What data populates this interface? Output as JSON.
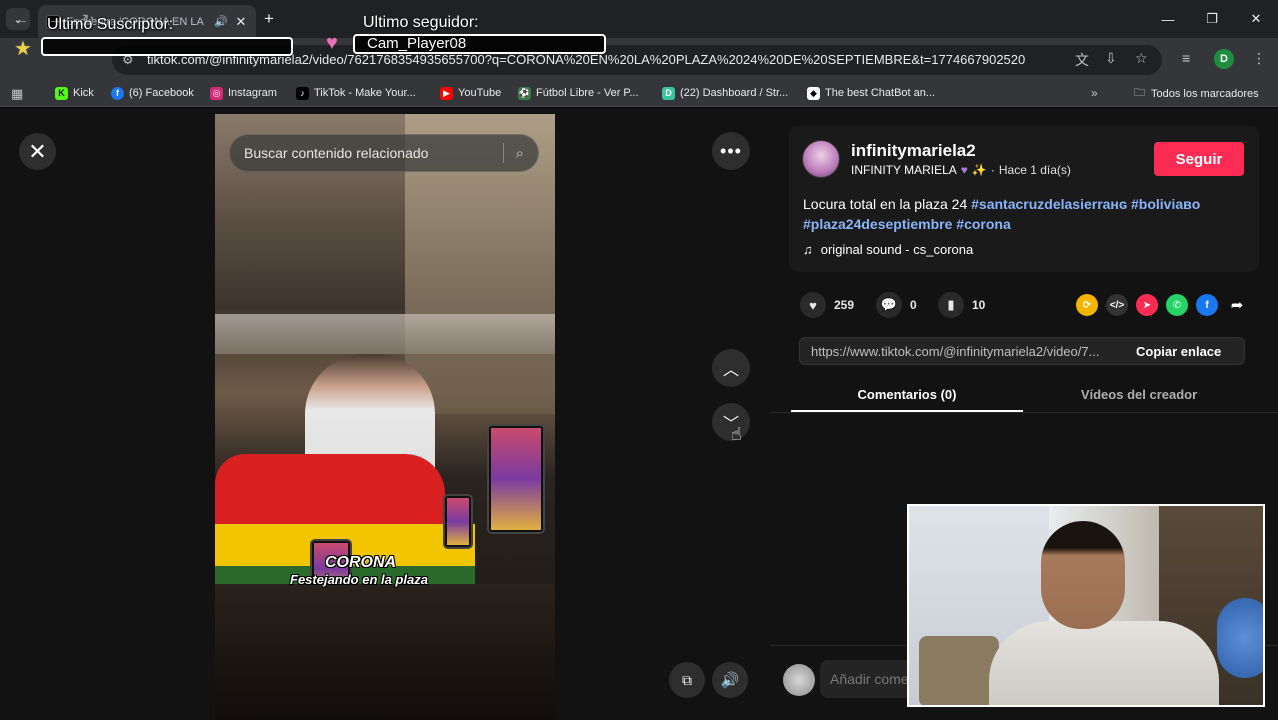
{
  "browser": {
    "tab_title": "Encuentra 'CORONA EN LA",
    "url": "tiktok.com/@infinitymariela2/video/7621768354935655700?q=CORONA%20EN%20LA%20PLAZA%2024%20DE%20SEPTIEMBRE&t=1774667902520",
    "profile_initial": "D",
    "bookmarks": [
      {
        "label": "Kick",
        "icon": "kick-icon",
        "color": "#53fc18"
      },
      {
        "label": "(6) Facebook",
        "icon": "facebook-icon",
        "color": "#1877f2"
      },
      {
        "label": "Instagram",
        "icon": "instagram-icon",
        "color": "#d62976"
      },
      {
        "label": "TikTok - Make Your...",
        "icon": "tiktok-icon",
        "color": "#000000"
      },
      {
        "label": "YouTube",
        "icon": "youtube-icon",
        "color": "#ff0000"
      },
      {
        "label": "Fútbol Libre - Ver P...",
        "icon": "futbol-icon",
        "color": "#3a7d44"
      },
      {
        "label": "(22) Dashboard / Str...",
        "icon": "dashboard-icon",
        "color": "#38c5a0"
      },
      {
        "label": "The best ChatBot an...",
        "icon": "chatbot-icon",
        "color": "#ffffff"
      }
    ],
    "bookmarks_folder": "Todos los marcadores"
  },
  "overlay": {
    "subscriber_label": "Ultimo Suscriptor:",
    "subscriber_value": "",
    "follower_label": "Ultimo seguidor:",
    "follower_value": "Cam_Player08"
  },
  "video": {
    "search_placeholder": "Buscar contenido relacionado",
    "caption_line1": "CORONA",
    "caption_line2": "Festejando en la plaza"
  },
  "post": {
    "username": "infinitymariela2",
    "nickname": "INFINITY MARIELA",
    "time": "Hace 1 día(s)",
    "follow_label": "Seguir",
    "description_text": "Locura total en la plaza 24 ",
    "hashtags": [
      "#santacruzdelasierraнɢ",
      "#boliviaвo",
      "#plaza24deseptiembre",
      "#corona"
    ],
    "sound": "original sound - cs_corona",
    "likes": "259",
    "comments": "0",
    "saves": "10",
    "link": "https://www.tiktok.com/@infinitymariela2/video/7...",
    "copy_label": "Copiar enlace",
    "tab_comments": "Comentarios (0)",
    "tab_videos": "Vídeos del creador",
    "comment_placeholder": "Añadir comentario..."
  },
  "colors": {
    "accent": "#fe2c55",
    "hashtag": "#8ab4f8",
    "background": "#121212"
  }
}
